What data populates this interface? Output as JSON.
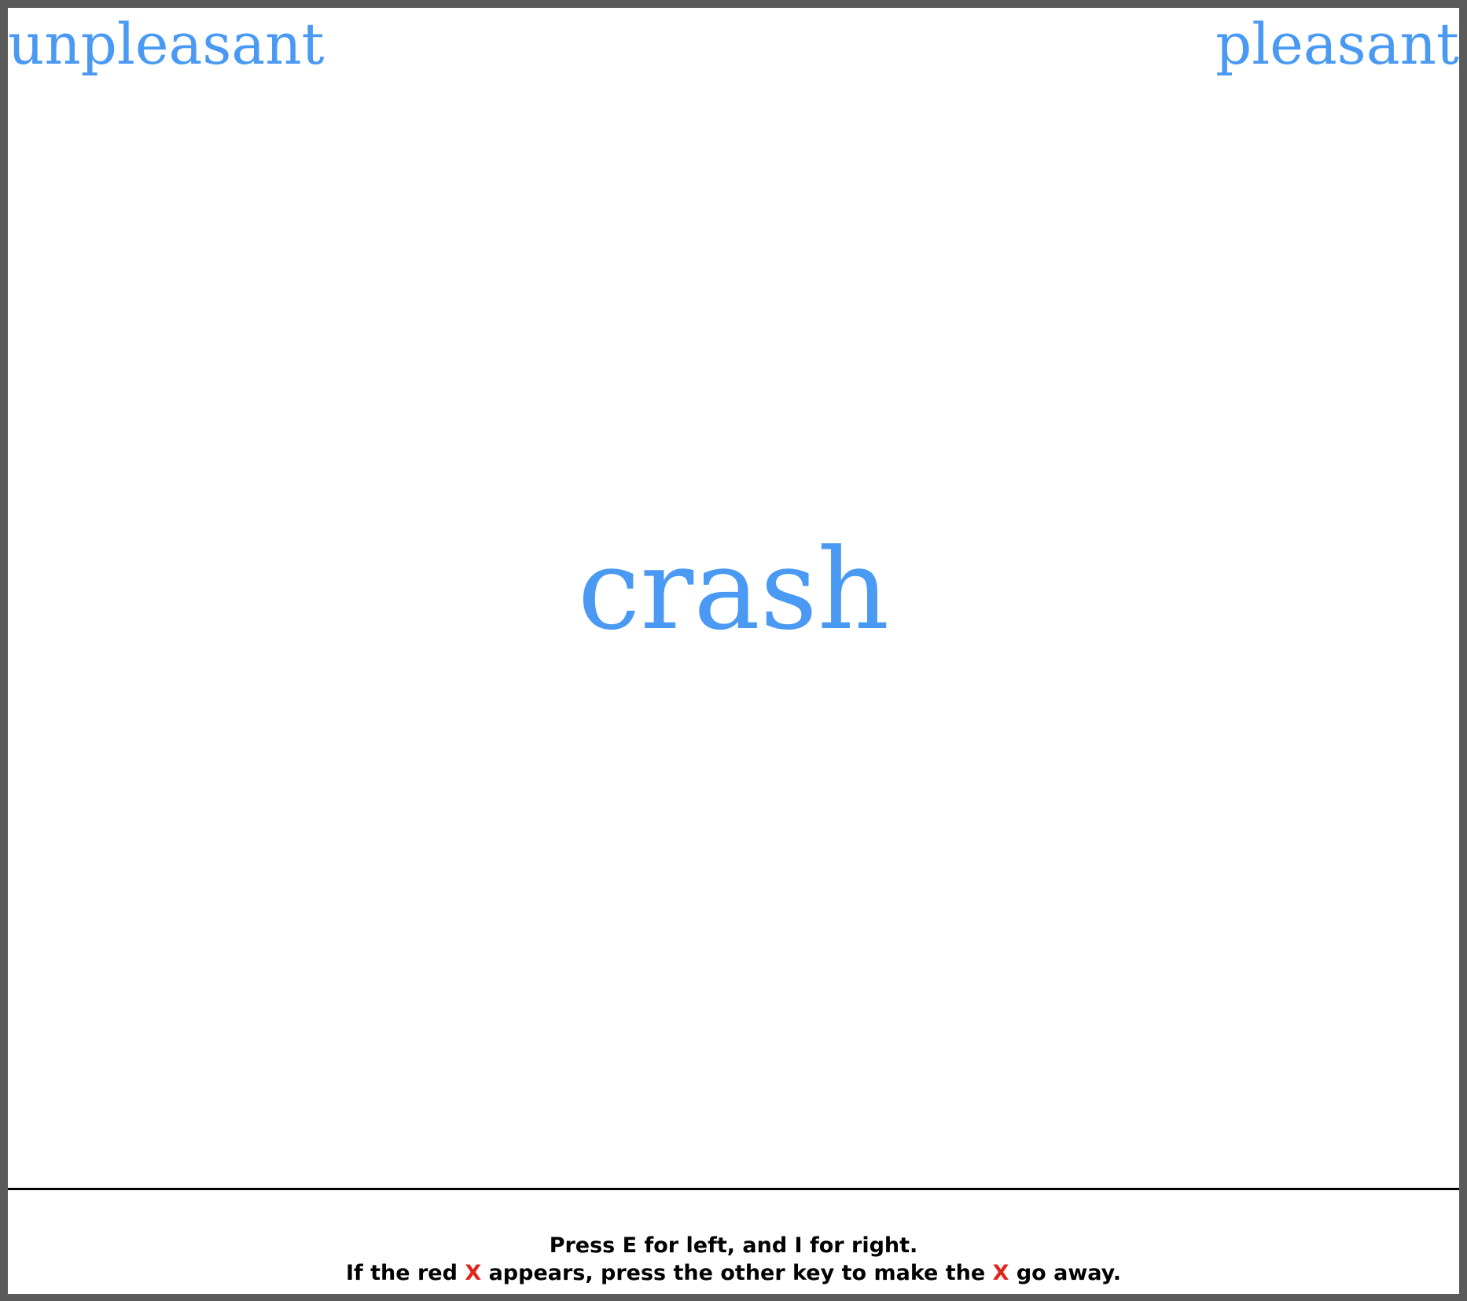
{
  "task": {
    "left_category": "unpleasant",
    "right_category": "pleasant",
    "stimulus_word": "crash"
  },
  "instructions": {
    "line1": "Press E for left, and I for right.",
    "line2_part1": "If the red ",
    "error_mark": "X",
    "line2_part2": " appears, press the other key to make the ",
    "line2_part3": " go away."
  },
  "colors": {
    "category_color": "#4a9af3",
    "stimulus_color": "#4a9af3",
    "error_mark_color": "#e0251b",
    "border": "#5a5a5a",
    "background": "#ffffff"
  }
}
